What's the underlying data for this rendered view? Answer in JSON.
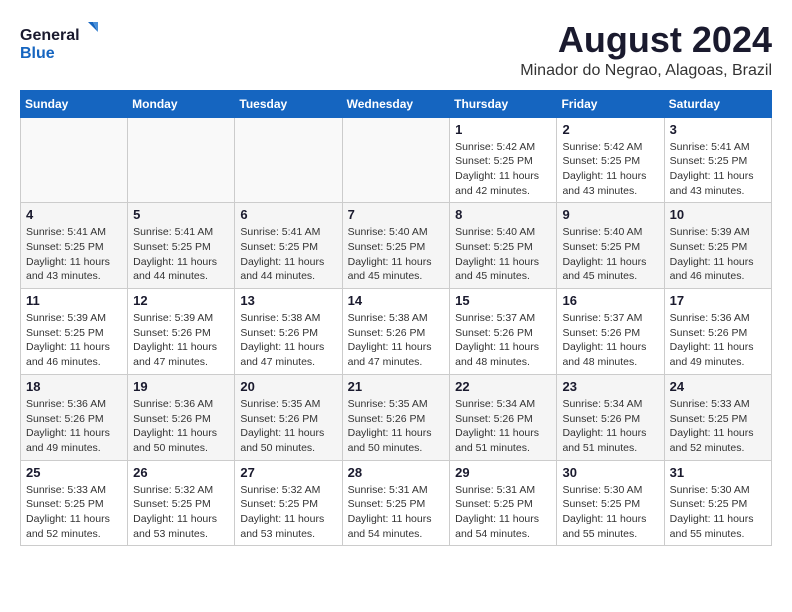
{
  "logo": {
    "line1": "General",
    "line2": "Blue"
  },
  "title": "August 2024",
  "subtitle": "Minador do Negrao, Alagoas, Brazil",
  "weekdays": [
    "Sunday",
    "Monday",
    "Tuesday",
    "Wednesday",
    "Thursday",
    "Friday",
    "Saturday"
  ],
  "weeks": [
    [
      {
        "day": "",
        "info": ""
      },
      {
        "day": "",
        "info": ""
      },
      {
        "day": "",
        "info": ""
      },
      {
        "day": "",
        "info": ""
      },
      {
        "day": "1",
        "info": "Sunrise: 5:42 AM\nSunset: 5:25 PM\nDaylight: 11 hours\nand 42 minutes."
      },
      {
        "day": "2",
        "info": "Sunrise: 5:42 AM\nSunset: 5:25 PM\nDaylight: 11 hours\nand 43 minutes."
      },
      {
        "day": "3",
        "info": "Sunrise: 5:41 AM\nSunset: 5:25 PM\nDaylight: 11 hours\nand 43 minutes."
      }
    ],
    [
      {
        "day": "4",
        "info": "Sunrise: 5:41 AM\nSunset: 5:25 PM\nDaylight: 11 hours\nand 43 minutes."
      },
      {
        "day": "5",
        "info": "Sunrise: 5:41 AM\nSunset: 5:25 PM\nDaylight: 11 hours\nand 44 minutes."
      },
      {
        "day": "6",
        "info": "Sunrise: 5:41 AM\nSunset: 5:25 PM\nDaylight: 11 hours\nand 44 minutes."
      },
      {
        "day": "7",
        "info": "Sunrise: 5:40 AM\nSunset: 5:25 PM\nDaylight: 11 hours\nand 45 minutes."
      },
      {
        "day": "8",
        "info": "Sunrise: 5:40 AM\nSunset: 5:25 PM\nDaylight: 11 hours\nand 45 minutes."
      },
      {
        "day": "9",
        "info": "Sunrise: 5:40 AM\nSunset: 5:25 PM\nDaylight: 11 hours\nand 45 minutes."
      },
      {
        "day": "10",
        "info": "Sunrise: 5:39 AM\nSunset: 5:25 PM\nDaylight: 11 hours\nand 46 minutes."
      }
    ],
    [
      {
        "day": "11",
        "info": "Sunrise: 5:39 AM\nSunset: 5:25 PM\nDaylight: 11 hours\nand 46 minutes."
      },
      {
        "day": "12",
        "info": "Sunrise: 5:39 AM\nSunset: 5:26 PM\nDaylight: 11 hours\nand 47 minutes."
      },
      {
        "day": "13",
        "info": "Sunrise: 5:38 AM\nSunset: 5:26 PM\nDaylight: 11 hours\nand 47 minutes."
      },
      {
        "day": "14",
        "info": "Sunrise: 5:38 AM\nSunset: 5:26 PM\nDaylight: 11 hours\nand 47 minutes."
      },
      {
        "day": "15",
        "info": "Sunrise: 5:37 AM\nSunset: 5:26 PM\nDaylight: 11 hours\nand 48 minutes."
      },
      {
        "day": "16",
        "info": "Sunrise: 5:37 AM\nSunset: 5:26 PM\nDaylight: 11 hours\nand 48 minutes."
      },
      {
        "day": "17",
        "info": "Sunrise: 5:36 AM\nSunset: 5:26 PM\nDaylight: 11 hours\nand 49 minutes."
      }
    ],
    [
      {
        "day": "18",
        "info": "Sunrise: 5:36 AM\nSunset: 5:26 PM\nDaylight: 11 hours\nand 49 minutes."
      },
      {
        "day": "19",
        "info": "Sunrise: 5:36 AM\nSunset: 5:26 PM\nDaylight: 11 hours\nand 50 minutes."
      },
      {
        "day": "20",
        "info": "Sunrise: 5:35 AM\nSunset: 5:26 PM\nDaylight: 11 hours\nand 50 minutes."
      },
      {
        "day": "21",
        "info": "Sunrise: 5:35 AM\nSunset: 5:26 PM\nDaylight: 11 hours\nand 50 minutes."
      },
      {
        "day": "22",
        "info": "Sunrise: 5:34 AM\nSunset: 5:26 PM\nDaylight: 11 hours\nand 51 minutes."
      },
      {
        "day": "23",
        "info": "Sunrise: 5:34 AM\nSunset: 5:26 PM\nDaylight: 11 hours\nand 51 minutes."
      },
      {
        "day": "24",
        "info": "Sunrise: 5:33 AM\nSunset: 5:25 PM\nDaylight: 11 hours\nand 52 minutes."
      }
    ],
    [
      {
        "day": "25",
        "info": "Sunrise: 5:33 AM\nSunset: 5:25 PM\nDaylight: 11 hours\nand 52 minutes."
      },
      {
        "day": "26",
        "info": "Sunrise: 5:32 AM\nSunset: 5:25 PM\nDaylight: 11 hours\nand 53 minutes."
      },
      {
        "day": "27",
        "info": "Sunrise: 5:32 AM\nSunset: 5:25 PM\nDaylight: 11 hours\nand 53 minutes."
      },
      {
        "day": "28",
        "info": "Sunrise: 5:31 AM\nSunset: 5:25 PM\nDaylight: 11 hours\nand 54 minutes."
      },
      {
        "day": "29",
        "info": "Sunrise: 5:31 AM\nSunset: 5:25 PM\nDaylight: 11 hours\nand 54 minutes."
      },
      {
        "day": "30",
        "info": "Sunrise: 5:30 AM\nSunset: 5:25 PM\nDaylight: 11 hours\nand 55 minutes."
      },
      {
        "day": "31",
        "info": "Sunrise: 5:30 AM\nSunset: 5:25 PM\nDaylight: 11 hours\nand 55 minutes."
      }
    ]
  ]
}
